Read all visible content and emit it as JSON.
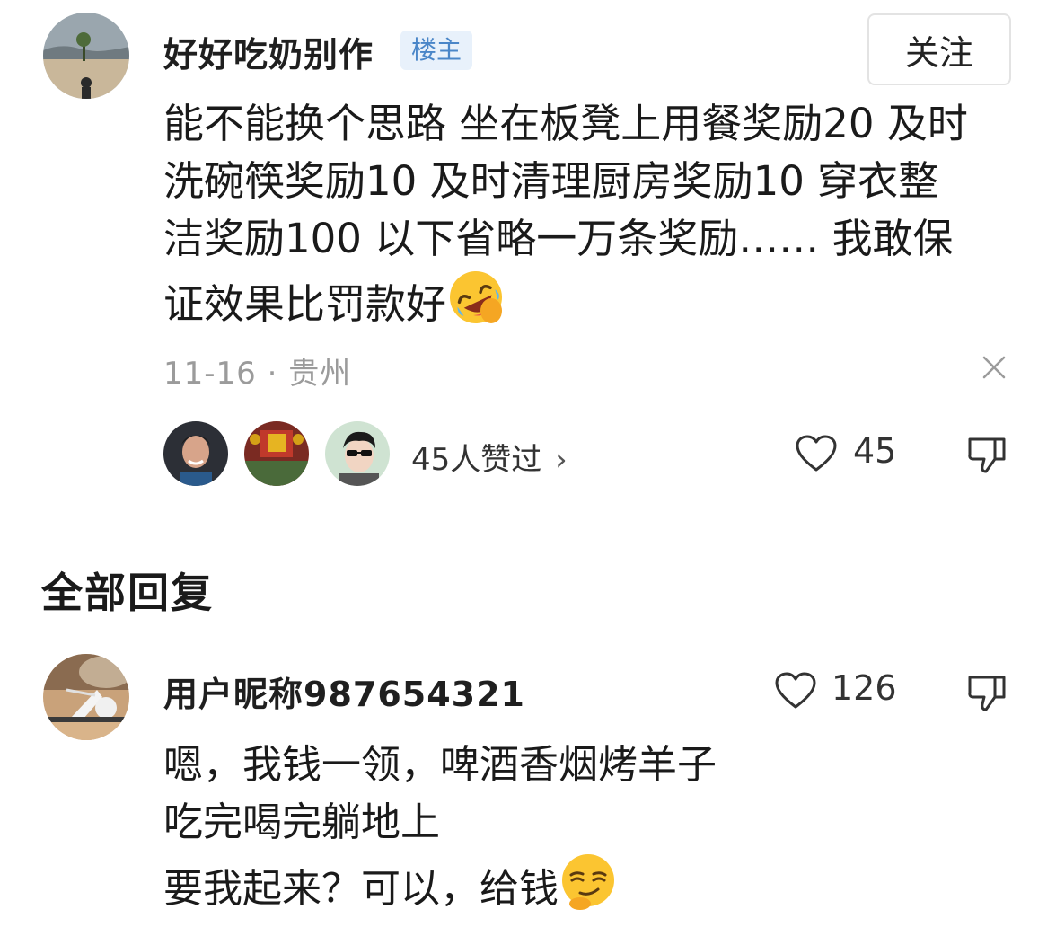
{
  "post": {
    "username": "好好吃奶别作",
    "op_badge": "楼主",
    "follow_label": "关注",
    "lines": [
      "能不能换个思路 坐在板凳上用餐奖励20 及时",
      "洗碗筷奖励10 及时清理厨房奖励10 穿衣整",
      "洁奖励100 以下省略一万条奖励…… 我敢保",
      "证效果比罚款好"
    ],
    "emoji": "rofl-emoji",
    "date": "11-16",
    "separator": "·",
    "location": "贵州",
    "likers_text": "45人赞过",
    "likers_chevron": "›",
    "like_count": "45"
  },
  "section": {
    "title": "全部回复"
  },
  "reply": {
    "username": "用户昵称987654321",
    "like_count": "126",
    "lines": [
      "嗯，我钱一领，啤酒香烟烤羊子",
      "吃完喝完躺地上",
      "要我起来？可以，给钱"
    ],
    "emoji": "smirk-emoji"
  },
  "colors": {
    "badge_bg": "#e8f1fb",
    "badge_text": "#4a86c8",
    "meta_text": "#9b9b9b",
    "text": "#1a1a1a"
  }
}
